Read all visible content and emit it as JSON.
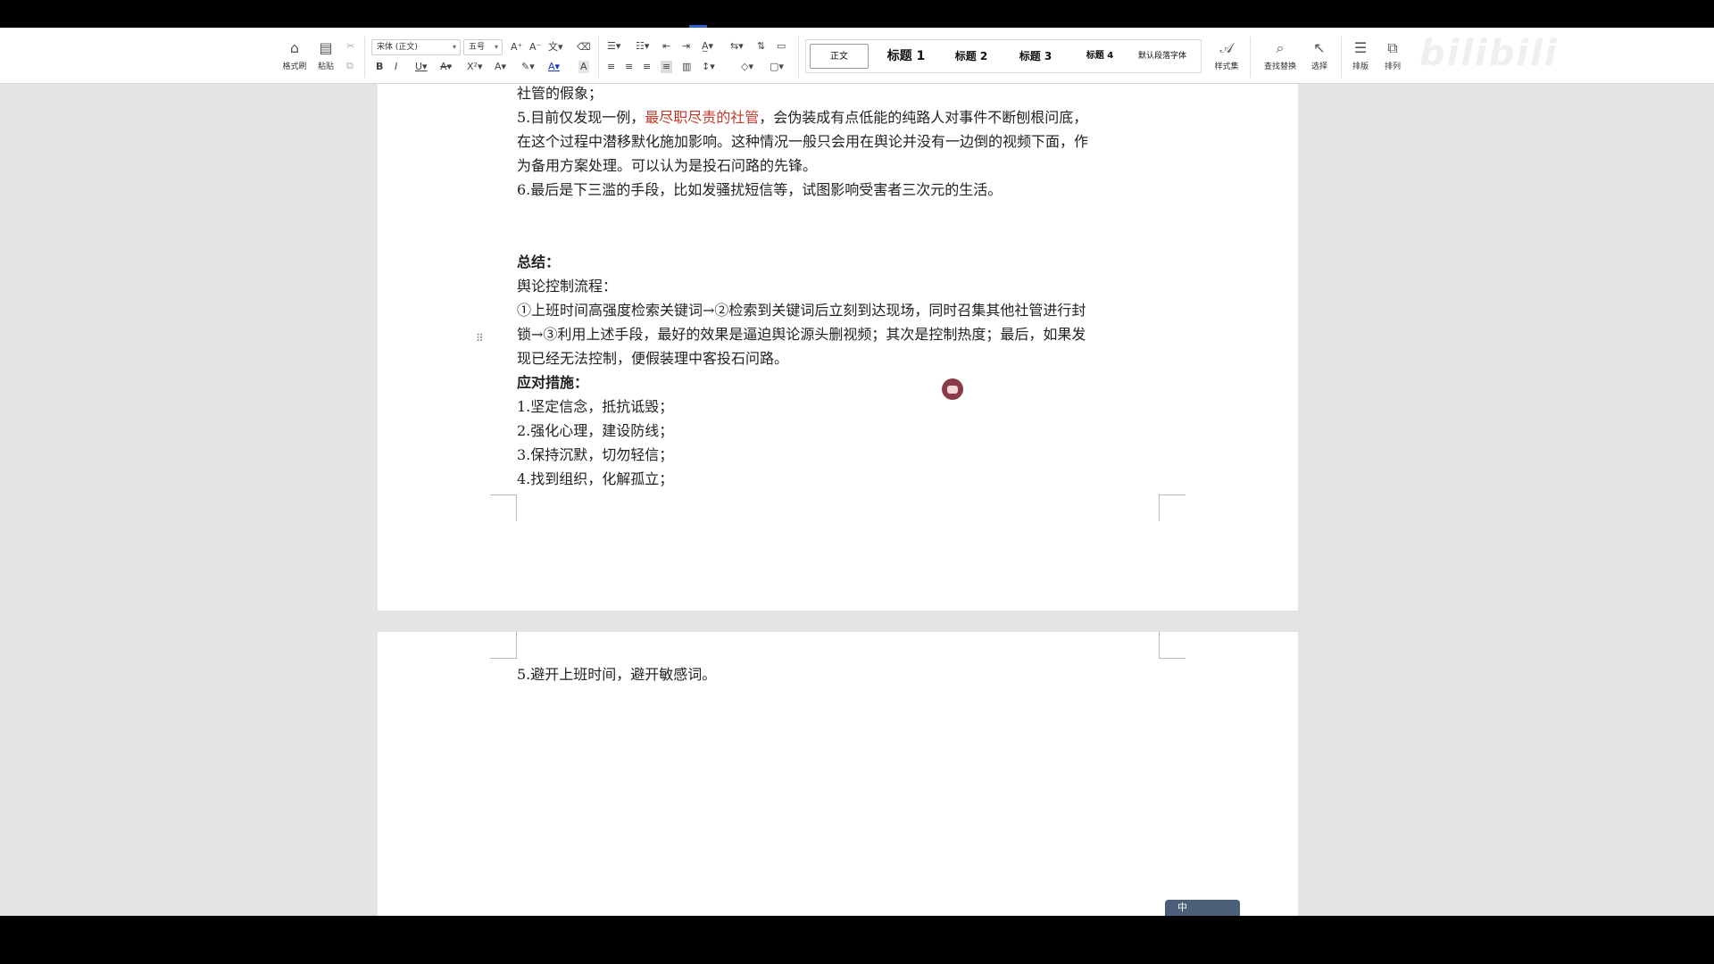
{
  "ribbon": {
    "format_painter": "格式刷",
    "paste": "粘贴",
    "font_name": "宋体 (正文)",
    "font_size": "五号",
    "styles": [
      "正文",
      "标题 1",
      "标题 2",
      "标题 3",
      "标题 4",
      "默认段落字体"
    ],
    "style_set": "样式集",
    "find_replace": "查找替换",
    "select": "选择",
    "layout": "排版",
    "arrange": "排列",
    "watermark": "bilibili"
  },
  "doc": {
    "page1_lines": [
      "社管的假象；",
      "",
      "在这个过程中潜移默化施加影响。这种情况一般只会用在舆论并没有一边倒的视频下面，作",
      "为备用方案处理。可以认为是投石问路的先锋。",
      "6.最后是下三滥的手段，比如发骚扰短信等，试图影响受害者三次元的生活。"
    ],
    "line5_prefix": "5.目前仅发现一例，",
    "line5_highlight": "最尽职尽责的社管",
    "line5_suffix": "，会伪装成有点低能的纯路人对事件不断刨根问底，",
    "summary_title": "总结：",
    "flow_title": "舆论控制流程：",
    "flow_lines": [
      "①上班时间高强度检索关键词→②检索到关键词后立刻到达现场，同时召集其他社管进行封",
      "锁→③利用上述手段，最好的效果是逼迫舆论源头删视频；其次是控制热度；最后，如果发",
      "现已经无法控制，便假装理中客投石问路。"
    ],
    "measures_title": "应对措施：",
    "measures": [
      "1.坚定信念，抵抗诋毁；",
      "2.强化心理，建设防线；",
      "3.保持沉默，切勿轻信；",
      "4.找到组织，化解孤立；"
    ],
    "page2_line": "5.避开上班时间，避开敏感词。"
  },
  "ime": {
    "label": "中"
  },
  "colors": {
    "highlight": "#c0392b",
    "page": "#ffffff",
    "workspace": "#e4e4e4"
  }
}
